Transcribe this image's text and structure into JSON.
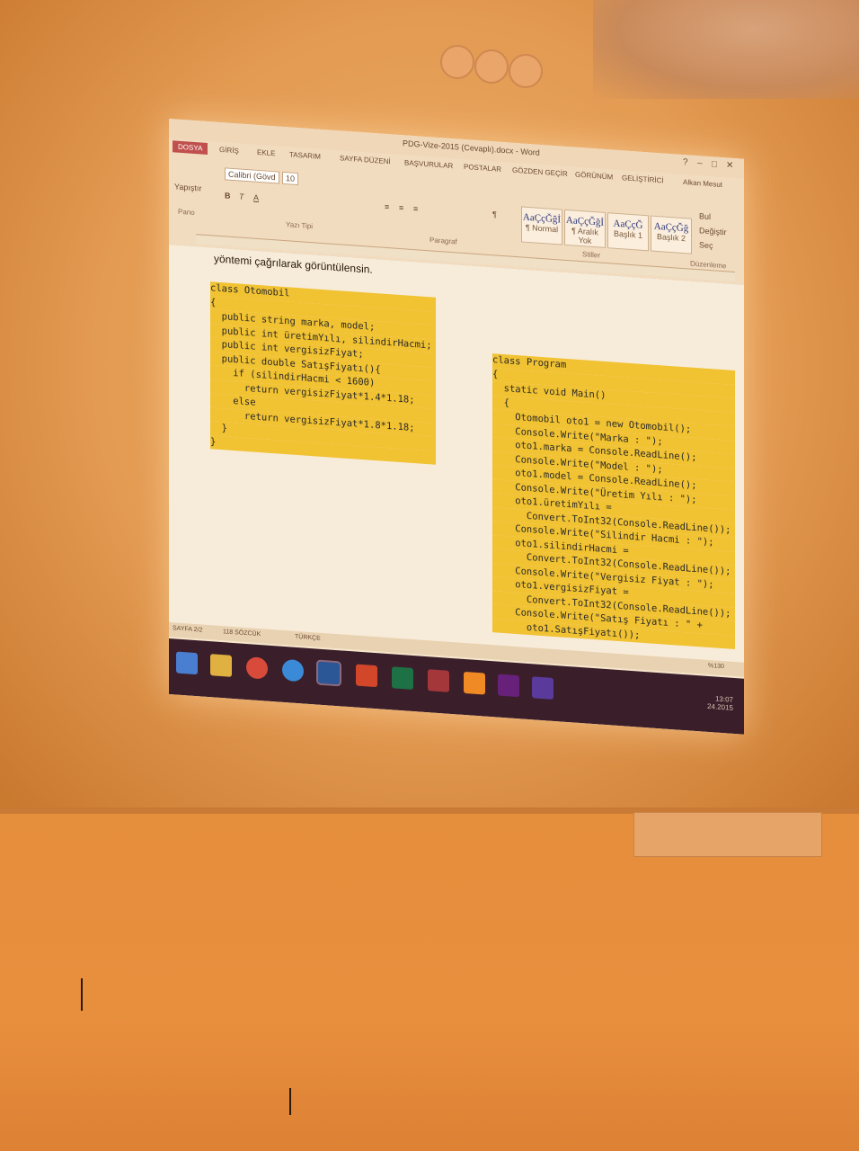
{
  "window": {
    "title": "PDG-Vize-2015 (Cevaplı).docx - Word",
    "controls": [
      "?",
      "–",
      "□",
      "✕"
    ]
  },
  "ribbon": {
    "tabs": [
      "DOSYA",
      "GİRİŞ",
      "EKLE",
      "TASARIM",
      "SAYFA DÜZENİ",
      "BAŞVURULAR",
      "POSTALAR",
      "GÖZDEN GEÇİR",
      "GÖRÜNÜM",
      "GELİŞTİRİCİ"
    ],
    "active_tab": "DOSYA",
    "user": "Alkan Mesut",
    "paste_label": "Yapıştır",
    "font_name": "Calibri (Gövd",
    "font_size": "10",
    "groups": [
      "Pano",
      "Yazı Tipi",
      "Paragraf",
      "Stiller",
      "Düzenleme"
    ],
    "styles": [
      {
        "sample": "AaÇçĞğİ",
        "name": "¶ Normal"
      },
      {
        "sample": "AaÇçĞğİ",
        "name": "¶ Aralık Yok"
      },
      {
        "sample": "AaÇçĞ",
        "name": "Başlık 1"
      },
      {
        "sample": "AaÇçĞğ",
        "name": "Başlık 2"
      }
    ],
    "editing": [
      "Bul",
      "Değiştir",
      "Seç"
    ]
  },
  "document": {
    "intro_text": "yöntemi çağrılarak görüntülensin.",
    "left_code": [
      "class Otomobil",
      "{",
      "  public string marka, model;",
      "  public int üretimYılı, silindirHacmi;",
      "  public int vergisizFiyat;",
      "  public double SatışFiyatı(){",
      "    if (silindirHacmi < 1600)",
      "      return vergisizFiyat*1.4*1.18;",
      "    else",
      "      return vergisizFiyat*1.8*1.18;",
      "  }",
      "}"
    ],
    "right_code": [
      "class Program",
      "{",
      "  static void Main()",
      "  {",
      "    Otomobil oto1 = new Otomobil();",
      "    Console.Write(\"Marka : \");",
      "    oto1.marka = Console.ReadLine();",
      "    Console.Write(\"Model : \");",
      "    oto1.model = Console.ReadLine();",
      "    Console.Write(\"Üretim Yılı : \");",
      "    oto1.üretimYılı =",
      "      Convert.ToInt32(Console.ReadLine());",
      "    Console.Write(\"Silindir Hacmi : \");",
      "    oto1.silindirHacmi =",
      "      Convert.ToInt32(Console.ReadLine());",
      "    Console.Write(\"Vergisiz Fiyat : \");",
      "    oto1.vergisizFiyat =",
      "      Convert.ToInt32(Console.ReadLine());",
      "    Console.Write(\"Satış Fiyatı : \" +",
      "      oto1.SatışFiyatı());"
    ]
  },
  "statusbar": {
    "page": "SAYFA 2/2",
    "words": "118 SÖZCÜK",
    "language": "TÜRKÇE",
    "zoom": "%130"
  },
  "taskbar": {
    "icons": [
      "windows-start-icon",
      "file-explorer-icon",
      "chrome-icon",
      "internet-explorer-icon",
      "word-icon",
      "powerpoint-icon",
      "excel-icon",
      "access-icon",
      "sublime-icon",
      "visual-studio-icon",
      "visual-studio-2-icon"
    ],
    "time": "13:07",
    "date": "24.2015"
  }
}
